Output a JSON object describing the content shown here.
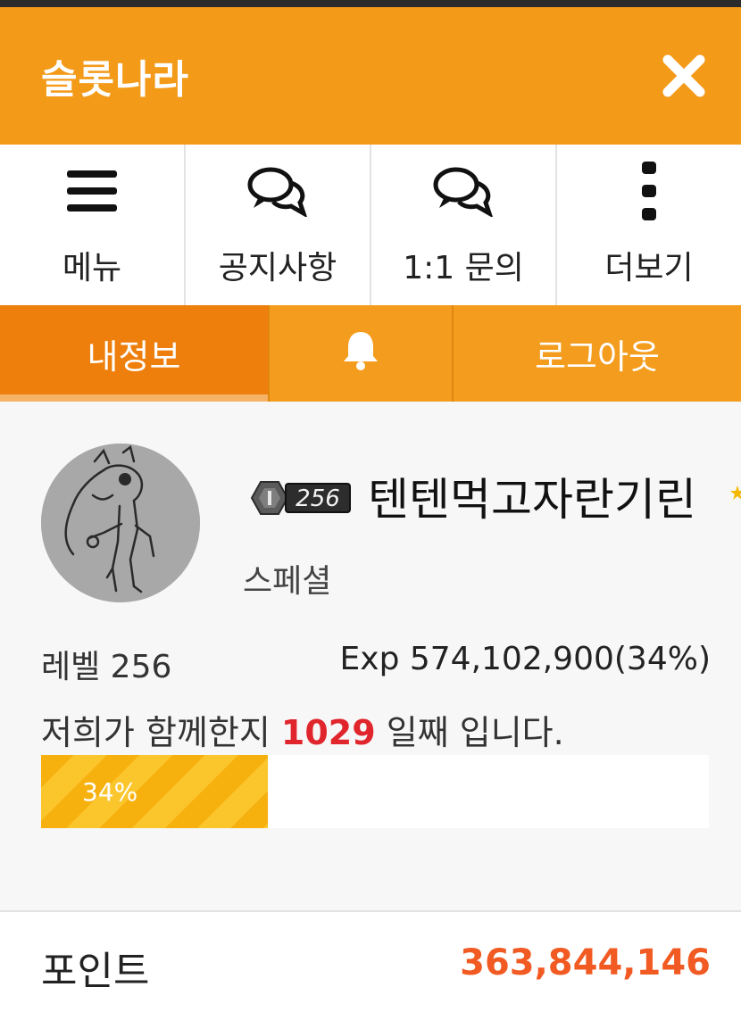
{
  "header": {
    "title": "슬롯나라",
    "close_icon": "close-icon"
  },
  "quicknav": [
    {
      "label": "메뉴",
      "icon": "hamburger-menu-icon"
    },
    {
      "label": "공지사항",
      "icon": "chat-bubbles-icon"
    },
    {
      "label": "1:1 문의",
      "icon": "chat-bubbles-icon"
    },
    {
      "label": "더보기",
      "icon": "vertical-dots-icon"
    }
  ],
  "tabs": {
    "info": "내정보",
    "bell_icon": "bell-icon",
    "logout": "로그아웃"
  },
  "profile": {
    "level_badge": "256",
    "nickname": "텐텐먹고자란기린",
    "grade": "스페셜",
    "level_text": "레벨 256",
    "exp_text": "Exp 574,102,900(34%)",
    "days_prefix": "저희가 함께한지",
    "days_count": "1029",
    "days_suffix": "일째 입니다.",
    "progress_label": "34%",
    "progress_percent": 34
  },
  "points": {
    "label": "포인트",
    "value": "363,844,146"
  },
  "colors": {
    "brand_orange": "#f39a19",
    "active_tab": "#ee7f0c",
    "days_red": "#e0252c",
    "points_orange": "#f15a22",
    "progress_yellow": "#f7b10f"
  }
}
